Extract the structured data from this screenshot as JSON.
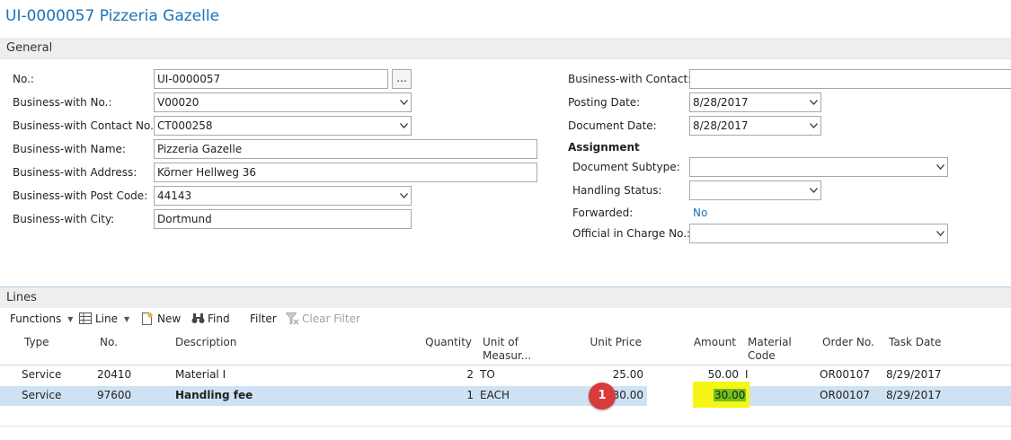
{
  "page": {
    "title": "UI-0000057 Pizzeria Gazelle"
  },
  "general": {
    "section_label": "General",
    "left_fields": [
      {
        "label": "No.:",
        "value": "UI-0000057"
      },
      {
        "label": "Business-with No.:",
        "value": "V00020"
      },
      {
        "label": "Business-with Contact No.:",
        "value": "CT000258"
      },
      {
        "label": "Business-with Name:",
        "value": "Pizzeria Gazelle"
      },
      {
        "label": "Business-with Address:",
        "value": "Körner Hellweg 36"
      },
      {
        "label": "Business-with Post Code:",
        "value": "44143"
      },
      {
        "label": "Business-with City:",
        "value": "Dortmund"
      }
    ],
    "assist_button_label": "...",
    "right_fields": [
      {
        "label": "Business-with Contact:",
        "value": ""
      },
      {
        "label": "Posting Date:",
        "value": "8/28/2017"
      },
      {
        "label": "Document Date:",
        "value": "8/28/2017"
      }
    ],
    "assignment": {
      "heading": "Assignment",
      "fields": [
        {
          "label": "Document Subtype:",
          "value": ""
        },
        {
          "label": "Handling Status:",
          "value": ""
        },
        {
          "label": "Forwarded:",
          "value": "No"
        },
        {
          "label": "Official in Charge No.:",
          "value": ""
        }
      ]
    }
  },
  "lines": {
    "section_label": "Lines",
    "toolbar": {
      "functions": "Functions",
      "line": "Line",
      "new": "New",
      "find": "Find",
      "filter": "Filter",
      "clear_filter": "Clear Filter"
    },
    "columns": {
      "type": "Type",
      "no": "No.",
      "description": "Description",
      "quantity": "Quantity",
      "unit_line1": "Unit of",
      "unit_line2": "Measur...",
      "unit_price": "Unit Price",
      "amount": "Amount",
      "material_line1": "Material",
      "material_line2": "Code",
      "order_no": "Order No.",
      "task_date": "Task Date"
    },
    "rows": [
      {
        "type": "Service",
        "no": "20410",
        "description": "Material I",
        "quantity": "2",
        "unit": "TO",
        "unit_price": "25.00",
        "amount": "50.00",
        "material_code": "I",
        "order_no": "OR00107",
        "task_date": "8/29/2017"
      },
      {
        "type": "Service",
        "no": "97600",
        "description": "Handling fee",
        "quantity": "1",
        "unit": "EACH",
        "unit_price": "30.00",
        "amount": "30.00",
        "material_code": "",
        "order_no": "OR00107",
        "task_date": "8/29/2017"
      }
    ],
    "callout_number": "1"
  },
  "colors": {
    "title_blue": "#1a73b8",
    "selected_row": "#cfe2f3",
    "highlight_yellow": "#f5f516",
    "highlight_green": "#73c21a",
    "callout_red": "#d93a3a"
  }
}
